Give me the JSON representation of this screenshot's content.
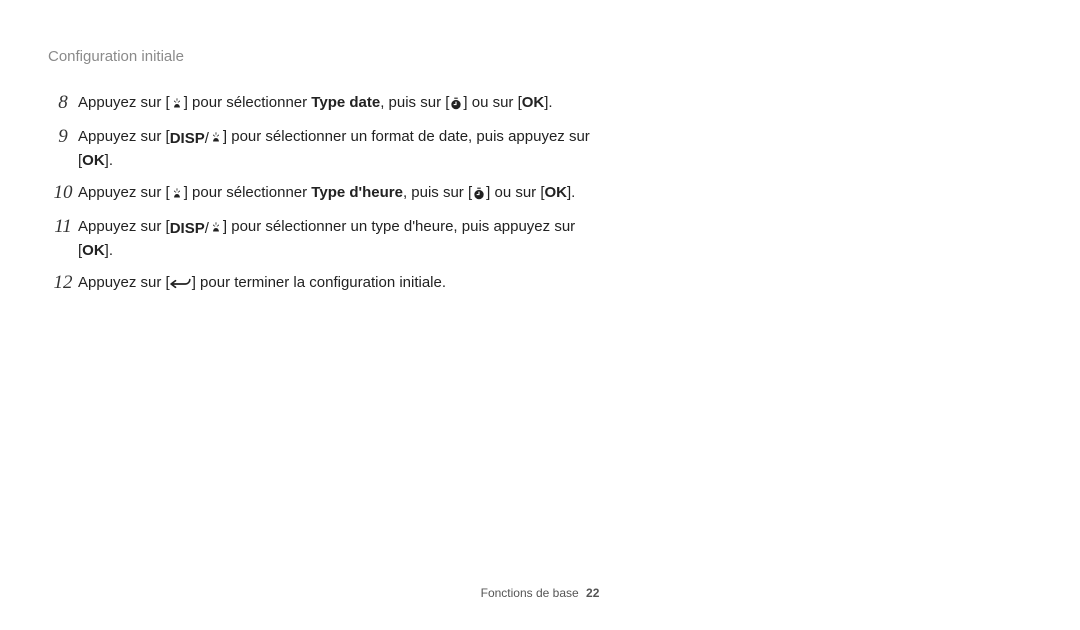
{
  "header": {
    "title": "Configuration initiale"
  },
  "steps": [
    {
      "num": "8",
      "pre": "Appuyez sur [",
      "icon1": "macro-icon",
      "mid1": "] pour sélectionner ",
      "bold": "Type date",
      "mid2": ", puis sur [",
      "icon2": "timer-icon",
      "mid3": "] ou sur [",
      "icon3": "ok-icon",
      "post": "]."
    },
    {
      "num": "9",
      "pre": "Appuyez sur [",
      "icon1": "disp-macro-icon",
      "mid1": "] pour sélectionner un format de date, puis appuyez sur [",
      "icon2": "ok-icon",
      "post": "]."
    },
    {
      "num": "10",
      "pre": "Appuyez sur [",
      "icon1": "macro-icon",
      "mid1": "] pour sélectionner ",
      "bold": "Type d'heure",
      "mid2": ", puis sur [",
      "icon2": "timer-icon",
      "mid3": "] ou sur [",
      "icon3": "ok-icon",
      "post": "]."
    },
    {
      "num": "11",
      "pre": "Appuyez sur [",
      "icon1": "disp-macro-icon",
      "mid1": "] pour sélectionner un type d'heure, puis appuyez sur [",
      "icon2": "ok-icon",
      "post": "]."
    },
    {
      "num": "12",
      "pre": "Appuyez sur [",
      "icon1": "back-icon",
      "mid1": "] pour terminer la configuration initiale.",
      "post": ""
    }
  ],
  "footer": {
    "section": "Fonctions de base",
    "page": "22"
  },
  "glyphs": {
    "ok": "OK",
    "disp": "DISP"
  }
}
